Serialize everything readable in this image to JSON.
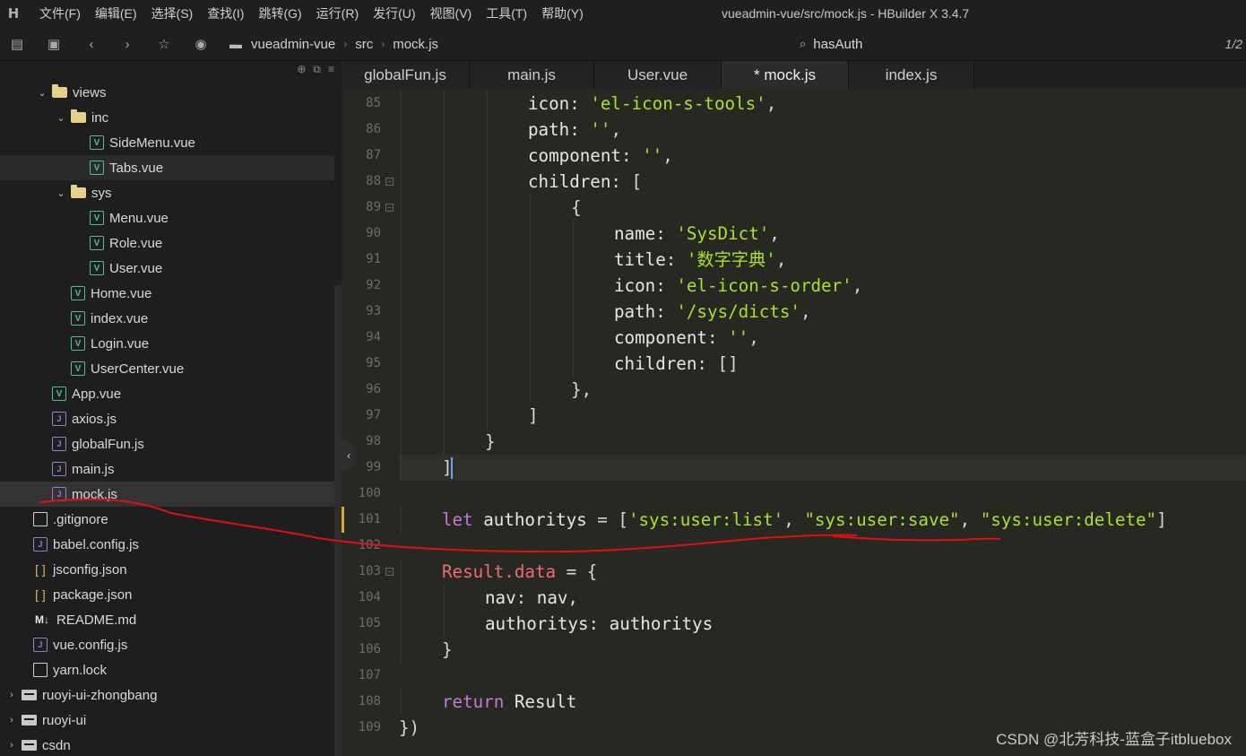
{
  "app": {
    "logo": "H",
    "window_title": "vueadmin-vue/src/mock.js - HBuilder X 3.4.7",
    "menu": [
      "文件(F)",
      "编辑(E)",
      "选择(S)",
      "查找(I)",
      "跳转(G)",
      "运行(R)",
      "发行(U)",
      "视图(V)",
      "工具(T)",
      "帮助(Y)"
    ]
  },
  "toolbar": {
    "icons": [
      "new-file-icon",
      "save-icon",
      "back-icon",
      "forward-icon",
      "star-icon",
      "run-icon"
    ],
    "breadcrumb": [
      "vueadmin-vue",
      "src",
      "mock.js"
    ],
    "search_value": "hasAuth",
    "page_counter": "1/2"
  },
  "sidebar": {
    "tree": [
      {
        "label": "views",
        "type": "folder",
        "expanded": true,
        "depth": 2
      },
      {
        "label": "inc",
        "type": "folder",
        "expanded": true,
        "depth": 3
      },
      {
        "label": "SideMenu.vue",
        "type": "vue",
        "depth": 4
      },
      {
        "label": "Tabs.vue",
        "type": "vue",
        "depth": 4,
        "state": "hover"
      },
      {
        "label": "sys",
        "type": "folder",
        "expanded": true,
        "depth": 3
      },
      {
        "label": "Menu.vue",
        "type": "vue",
        "depth": 4
      },
      {
        "label": "Role.vue",
        "type": "vue",
        "depth": 4
      },
      {
        "label": "User.vue",
        "type": "vue",
        "depth": 4
      },
      {
        "label": "Home.vue",
        "type": "vue",
        "depth": 3
      },
      {
        "label": "index.vue",
        "type": "vue",
        "depth": 3
      },
      {
        "label": "Login.vue",
        "type": "vue",
        "depth": 3
      },
      {
        "label": "UserCenter.vue",
        "type": "vue",
        "depth": 3
      },
      {
        "label": "App.vue",
        "type": "vue",
        "depth": 2
      },
      {
        "label": "axios.js",
        "type": "js",
        "depth": 2
      },
      {
        "label": "globalFun.js",
        "type": "js",
        "depth": 2
      },
      {
        "label": "main.js",
        "type": "js",
        "depth": 2
      },
      {
        "label": "mock.js",
        "type": "js",
        "depth": 2,
        "state": "active"
      },
      {
        "label": ".gitignore",
        "type": "file",
        "depth": 1
      },
      {
        "label": "babel.config.js",
        "type": "js",
        "depth": 1
      },
      {
        "label": "jsconfig.json",
        "type": "json",
        "depth": 1
      },
      {
        "label": "package.json",
        "type": "json",
        "depth": 1
      },
      {
        "label": "README.md",
        "type": "md",
        "depth": 1
      },
      {
        "label": "vue.config.js",
        "type": "js",
        "depth": 1
      },
      {
        "label": "yarn.lock",
        "type": "file",
        "depth": 1
      },
      {
        "label": "ruoyi-ui-zhongbang",
        "type": "project",
        "expanded": false,
        "depth": 0
      },
      {
        "label": "ruoyi-ui",
        "type": "project",
        "expanded": false,
        "depth": 0
      },
      {
        "label": "csdn",
        "type": "project",
        "expanded": false,
        "depth": 0
      }
    ]
  },
  "editor": {
    "tabs": [
      {
        "label": "globalFun.js",
        "active": false
      },
      {
        "label": "main.js",
        "active": false
      },
      {
        "label": "User.vue",
        "active": false
      },
      {
        "label": "* mock.js",
        "active": true
      },
      {
        "label": "index.js",
        "active": false
      }
    ],
    "lines": [
      {
        "n": "85",
        "indent": 3,
        "tokens": [
          [
            "k",
            "icon"
          ],
          [
            "p",
            ": "
          ],
          [
            "s",
            "'el-icon-s-tools'"
          ],
          [
            "p",
            ","
          ]
        ]
      },
      {
        "n": "86",
        "indent": 3,
        "tokens": [
          [
            "k",
            "path"
          ],
          [
            "p",
            ": "
          ],
          [
            "s",
            "''"
          ],
          [
            "p",
            ","
          ]
        ]
      },
      {
        "n": "87",
        "indent": 3,
        "tokens": [
          [
            "k",
            "component"
          ],
          [
            "p",
            ": "
          ],
          [
            "s",
            "''"
          ],
          [
            "p",
            ","
          ]
        ]
      },
      {
        "n": "88",
        "indent": 3,
        "fold": true,
        "tokens": [
          [
            "k",
            "children"
          ],
          [
            "p",
            ": ["
          ]
        ]
      },
      {
        "n": "89",
        "indent": 4,
        "fold": true,
        "tokens": [
          [
            "p",
            "{"
          ]
        ]
      },
      {
        "n": "90",
        "indent": 5,
        "tokens": [
          [
            "k",
            "name"
          ],
          [
            "p",
            ": "
          ],
          [
            "s",
            "'SysDict'"
          ],
          [
            "p",
            ","
          ]
        ]
      },
      {
        "n": "91",
        "indent": 5,
        "tokens": [
          [
            "k",
            "title"
          ],
          [
            "p",
            ": "
          ],
          [
            "s",
            "'数字字典'"
          ],
          [
            "p",
            ","
          ]
        ]
      },
      {
        "n": "92",
        "indent": 5,
        "tokens": [
          [
            "k",
            "icon"
          ],
          [
            "p",
            ": "
          ],
          [
            "s",
            "'el-icon-s-order'"
          ],
          [
            "p",
            ","
          ]
        ]
      },
      {
        "n": "93",
        "indent": 5,
        "tokens": [
          [
            "k",
            "path"
          ],
          [
            "p",
            ": "
          ],
          [
            "s",
            "'/sys/dicts'"
          ],
          [
            "p",
            ","
          ]
        ]
      },
      {
        "n": "94",
        "indent": 5,
        "tokens": [
          [
            "k",
            "component"
          ],
          [
            "p",
            ": "
          ],
          [
            "s",
            "''"
          ],
          [
            "p",
            ","
          ]
        ]
      },
      {
        "n": "95",
        "indent": 5,
        "tokens": [
          [
            "k",
            "children"
          ],
          [
            "p",
            ": []"
          ]
        ]
      },
      {
        "n": "96",
        "indent": 4,
        "tokens": [
          [
            "p",
            "},"
          ]
        ]
      },
      {
        "n": "97",
        "indent": 3,
        "tokens": [
          [
            "p",
            "]"
          ]
        ]
      },
      {
        "n": "98",
        "indent": 2,
        "tokens": [
          [
            "p",
            "}"
          ]
        ]
      },
      {
        "n": "99",
        "indent": 1,
        "current": true,
        "tokens": [
          [
            "p",
            "]"
          ]
        ]
      },
      {
        "n": "100",
        "indent": 0,
        "tokens": []
      },
      {
        "n": "101",
        "indent": 1,
        "modified": true,
        "tokens": [
          [
            "kw",
            "let"
          ],
          [
            "k",
            " authoritys "
          ],
          [
            "p",
            "= ["
          ],
          [
            "s",
            "'sys:user:list'"
          ],
          [
            "p",
            ", "
          ],
          [
            "s",
            "\"sys:user:save\""
          ],
          [
            "p",
            ", "
          ],
          [
            "s",
            "\"sys:user:delete\""
          ],
          [
            "p",
            "]"
          ]
        ]
      },
      {
        "n": "102",
        "indent": 0,
        "tokens": []
      },
      {
        "n": "103",
        "indent": 1,
        "fold": true,
        "tokens": [
          [
            "obj",
            "Result.data"
          ],
          [
            "p",
            " = {"
          ]
        ]
      },
      {
        "n": "104",
        "indent": 2,
        "tokens": [
          [
            "k",
            "nav"
          ],
          [
            "p",
            ": "
          ],
          [
            "k",
            "nav"
          ],
          [
            "p",
            ","
          ]
        ]
      },
      {
        "n": "105",
        "indent": 2,
        "tokens": [
          [
            "k",
            "authoritys"
          ],
          [
            "p",
            ": "
          ],
          [
            "k",
            "authoritys"
          ]
        ]
      },
      {
        "n": "106",
        "indent": 1,
        "tokens": [
          [
            "p",
            "}"
          ]
        ]
      },
      {
        "n": "107",
        "indent": 0,
        "tokens": []
      },
      {
        "n": "108",
        "indent": 1,
        "tokens": [
          [
            "kw",
            "return"
          ],
          [
            "k",
            " Result"
          ]
        ]
      },
      {
        "n": "109",
        "indent": 0,
        "tokens": [
          [
            "p",
            "})"
          ]
        ]
      }
    ]
  },
  "colors": {
    "annotation_stroke": "#e01010",
    "string": "#a6e22e",
    "keyword": "#c678dd",
    "object": "#ef6b73"
  },
  "watermark": "CSDN @北芳科技-蓝盒子itbluebox"
}
